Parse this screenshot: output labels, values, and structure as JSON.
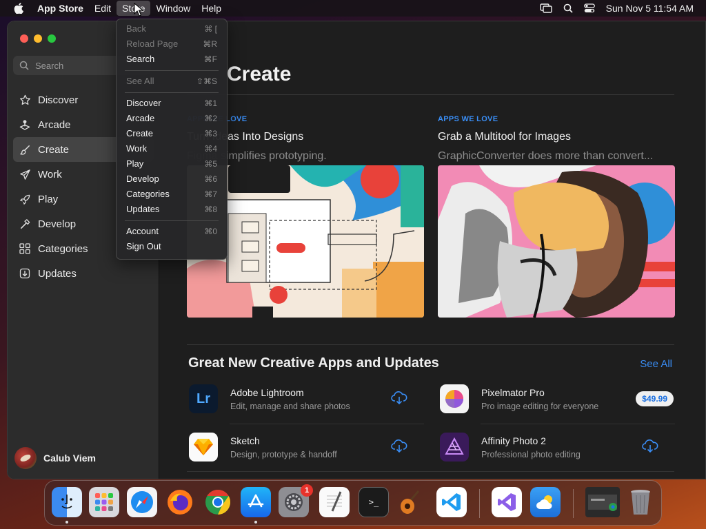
{
  "menubar": {
    "app_name": "App Store",
    "items": [
      "Edit",
      "Store",
      "Window",
      "Help"
    ],
    "clock": "Sun Nov 5  11:54 AM"
  },
  "sidebar": {
    "search_placeholder": "Search",
    "items": [
      {
        "label": "Discover",
        "icon": "star-icon"
      },
      {
        "label": "Arcade",
        "icon": "joystick-icon"
      },
      {
        "label": "Create",
        "icon": "paintbrush-icon",
        "selected": true
      },
      {
        "label": "Work",
        "icon": "paper-plane-icon"
      },
      {
        "label": "Play",
        "icon": "rocket-icon"
      },
      {
        "label": "Develop",
        "icon": "hammer-icon"
      },
      {
        "label": "Categories",
        "icon": "grid-icon"
      },
      {
        "label": "Updates",
        "icon": "download-icon"
      }
    ],
    "user_name": "Calub Viem"
  },
  "main": {
    "title": "Create",
    "cards": [
      {
        "kicker": "APPS WE LOVE",
        "title": "Turn Ideas Into Designs",
        "subtitle": "Figma simplifies prototyping."
      },
      {
        "kicker": "APPS WE LOVE",
        "title": "Grab a Multitool for Images",
        "subtitle": "GraphicConverter does more than convert..."
      }
    ],
    "section_title": "Great New Creative Apps and Updates",
    "see_all": "See All",
    "apps": [
      {
        "name": "Adobe Lightroom",
        "desc": "Edit, manage and share photos",
        "action": "download"
      },
      {
        "name": "Pixelmator Pro",
        "desc": "Pro image editing for everyone",
        "action": "price",
        "price": "$49.99"
      },
      {
        "name": "Sketch",
        "desc": "Design, prototype & handoff",
        "action": "download"
      },
      {
        "name": "Affinity Photo 2",
        "desc": "Professional photo editing",
        "action": "download"
      }
    ]
  },
  "store_menu": {
    "items": [
      {
        "label": "Back",
        "shortcut": "⌘ [",
        "disabled": true
      },
      {
        "label": "Reload Page",
        "shortcut": "⌘R",
        "disabled": true
      },
      {
        "label": "Search",
        "shortcut": "⌘F"
      },
      {
        "label": "See All",
        "shortcut": "⇧⌘S",
        "disabled": true
      },
      {
        "label": "Discover",
        "shortcut": "⌘1"
      },
      {
        "label": "Arcade",
        "shortcut": "⌘2"
      },
      {
        "label": "Create",
        "shortcut": "⌘3"
      },
      {
        "label": "Work",
        "shortcut": "⌘4"
      },
      {
        "label": "Play",
        "shortcut": "⌘5"
      },
      {
        "label": "Develop",
        "shortcut": "⌘6"
      },
      {
        "label": "Categories",
        "shortcut": "⌘7"
      },
      {
        "label": "Updates",
        "shortcut": "⌘8"
      },
      {
        "label": "Account",
        "shortcut": "⌘0"
      },
      {
        "label": "Sign Out",
        "shortcut": ""
      }
    ]
  },
  "dock": {
    "apps": [
      "finder-icon",
      "launchpad-icon",
      "safari-icon",
      "firefox-icon",
      "chrome-icon",
      "app-store-icon",
      "system-settings-icon",
      "textedit-icon",
      "terminal-icon",
      "garageband-icon",
      "vscode-icon",
      "visual-studio-icon",
      "weather-icon",
      "window-thumbnail-icon",
      "trash-icon"
    ],
    "settings_badge": "1"
  },
  "colors": {
    "accent": "#3a8ef6",
    "selected": "#444444",
    "sidebar": "#2c2c2c",
    "content": "#1e1e1e"
  }
}
